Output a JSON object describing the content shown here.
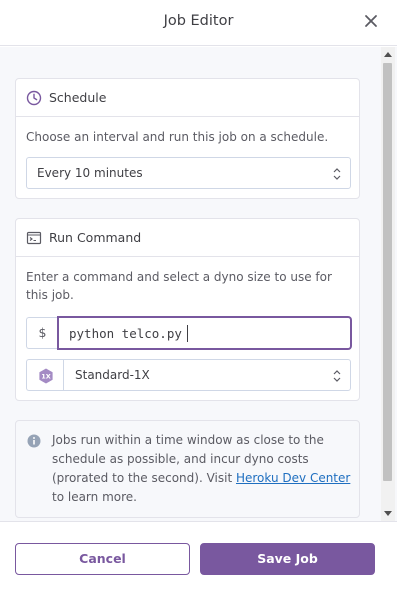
{
  "header": {
    "title": "Job Editor",
    "close_icon": "close-icon"
  },
  "schedule": {
    "heading": "Schedule",
    "icon": "clock-icon",
    "description": "Choose an interval and run this job on a schedule.",
    "interval_value": "Every 10 minutes"
  },
  "run_command": {
    "heading": "Run Command",
    "icon": "terminal-icon",
    "description": "Enter a command and select a dyno size to use for this job.",
    "prefix": "$",
    "command_value": "python telco.py",
    "dyno_badge": "1X",
    "dyno_value": "Standard-1X"
  },
  "info": {
    "icon": "info-icon",
    "text_before": "Jobs run within a time window as close to the schedule as possible, and incur dyno costs (prorated to the second). Visit ",
    "link_text": "Heroku Dev Center",
    "text_after": " to learn more."
  },
  "footer": {
    "cancel_label": "Cancel",
    "save_label": "Save Job"
  },
  "colors": {
    "accent": "#79589f",
    "link": "#1f6fc0",
    "border": "#e3e3ea",
    "background": "#f7f8fb"
  }
}
